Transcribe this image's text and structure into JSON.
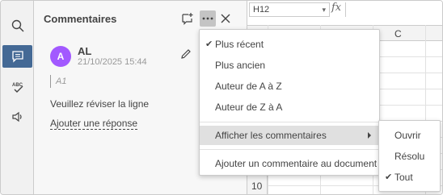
{
  "panel": {
    "title": "Commentaires",
    "comment": {
      "avatar_initial": "A",
      "avatar_color": "#a259ff",
      "author": "AL",
      "date": "21/10/2025 15:44",
      "cell_ref": "A1",
      "text": "Veuillez réviser la ligne",
      "reply_link": "Ajouter une réponse"
    }
  },
  "sheet": {
    "name_box": "H12",
    "fx_label": "fx",
    "visible_column": "C",
    "visible_row": "10"
  },
  "menu": {
    "items": [
      {
        "label": "Plus récent",
        "checked": true
      },
      {
        "label": "Plus ancien",
        "checked": false
      },
      {
        "label": "Auteur de A à Z",
        "checked": false
      },
      {
        "label": "Auteur de Z à A",
        "checked": false
      }
    ],
    "show_comments": "Afficher les commentaires",
    "add_comment": "Ajouter un commentaire au document"
  },
  "submenu": {
    "items": [
      {
        "label": "Ouvrir",
        "checked": false
      },
      {
        "label": "Résolu",
        "checked": false
      },
      {
        "label": "Tout",
        "checked": true
      }
    ]
  },
  "icons": [
    "search-icon",
    "comment-icon",
    "spellcheck-icon",
    "speaker-icon",
    "add-comment-icon",
    "more-icon",
    "close-icon",
    "edit-icon"
  ],
  "colors": {
    "accent": "#446995",
    "avatar": "#a259ff"
  }
}
